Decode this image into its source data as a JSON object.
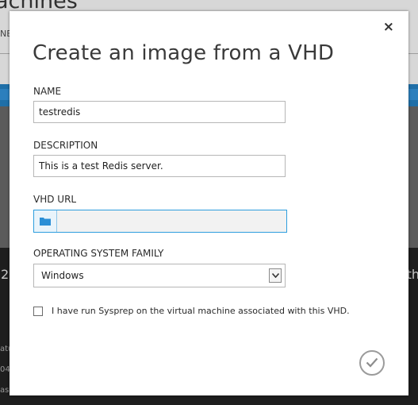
{
  "background": {
    "title_fragment": "achines",
    "nav_fragment": "NE",
    "left_number": "2",
    "right_fragment": "th",
    "small_rows": [
      "atu",
      "04-",
      "as"
    ]
  },
  "dialog": {
    "title": "Create an image from a VHD",
    "close_glyph": "×",
    "name": {
      "label": "NAME",
      "value": "testredis"
    },
    "description": {
      "label": "DESCRIPTION",
      "value": "This is a test Redis server."
    },
    "vhd_url": {
      "label": "VHD URL",
      "value": ""
    },
    "os_family": {
      "label": "OPERATING SYSTEM FAMILY",
      "selected": "Windows"
    },
    "sysprep": {
      "label": "I have run Sysprep on the virtual machine associated with this VHD.",
      "checked": false
    },
    "ok_icon": "checkmark-icon"
  },
  "colors": {
    "accent": "#2e9ede",
    "folder_icon": "#2b8fd6"
  }
}
